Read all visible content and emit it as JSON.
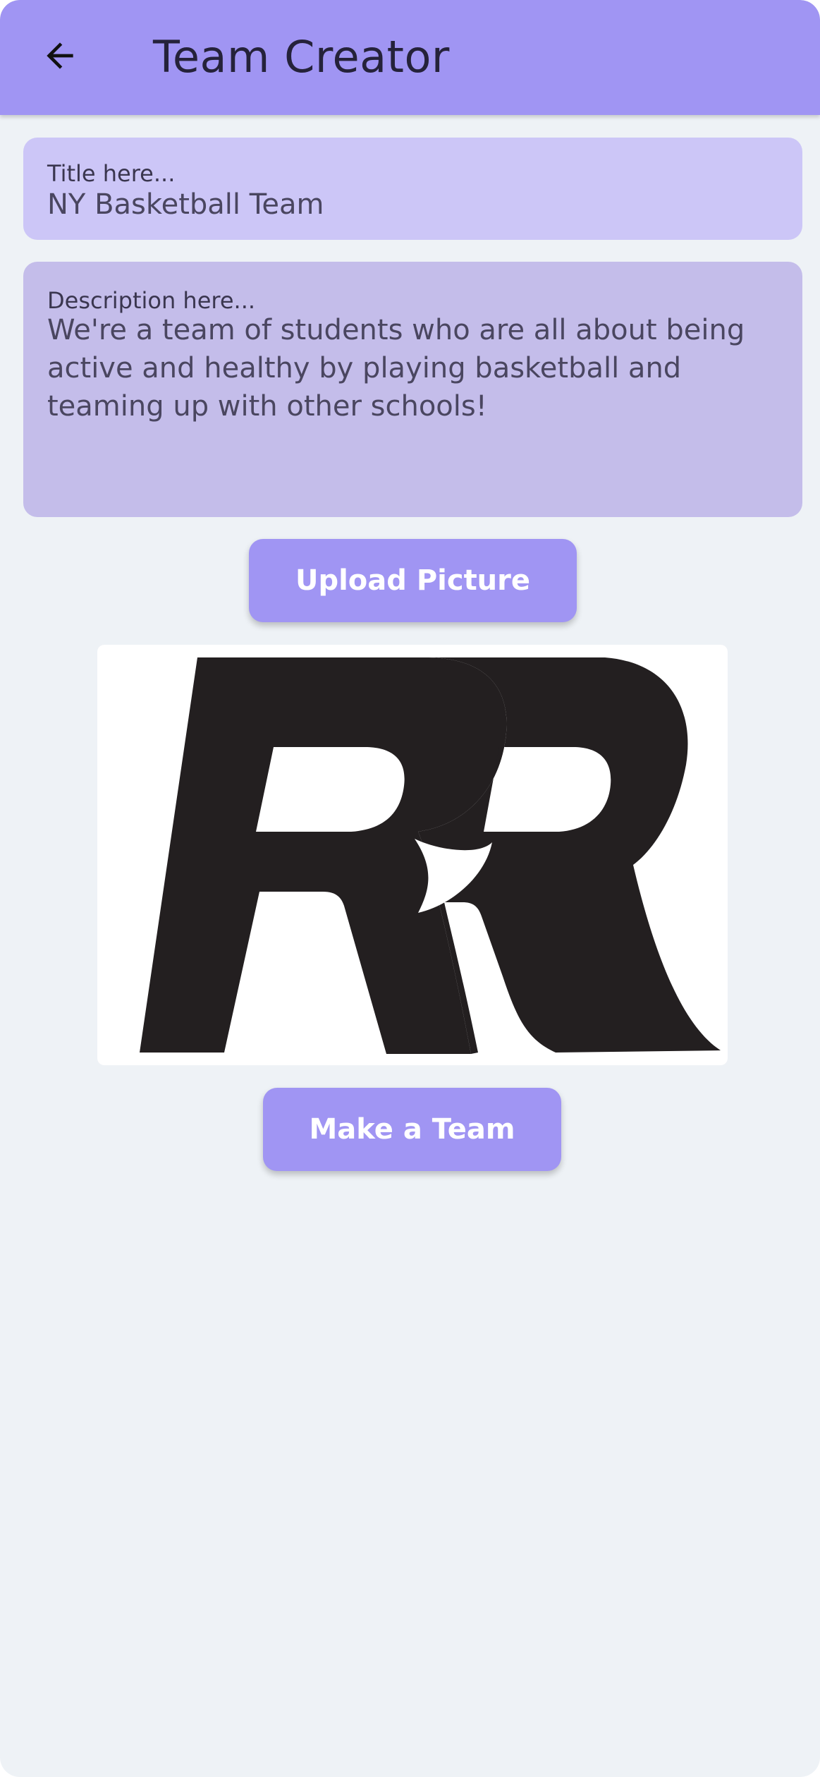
{
  "header": {
    "title": "Team Creator",
    "back_icon": "arrow-left-icon"
  },
  "form": {
    "title_field": {
      "label": "Title here...",
      "value": "NY Basketball Team"
    },
    "description_field": {
      "label": "Description here...",
      "value": "We're a team of students who are all about being active and healthy by playing basketball and teaming up with other schools!"
    },
    "upload_button_label": "Upload Picture",
    "image": {
      "name": "team-logo",
      "logo_text": "RR"
    },
    "make_team_button_label": "Make a Team"
  },
  "colors": {
    "accent": "#a095f3",
    "background": "#eef2f6",
    "title_field_bg": "#ccc6f7",
    "description_field_bg": "#c4bdea",
    "logo": "#231f20"
  }
}
